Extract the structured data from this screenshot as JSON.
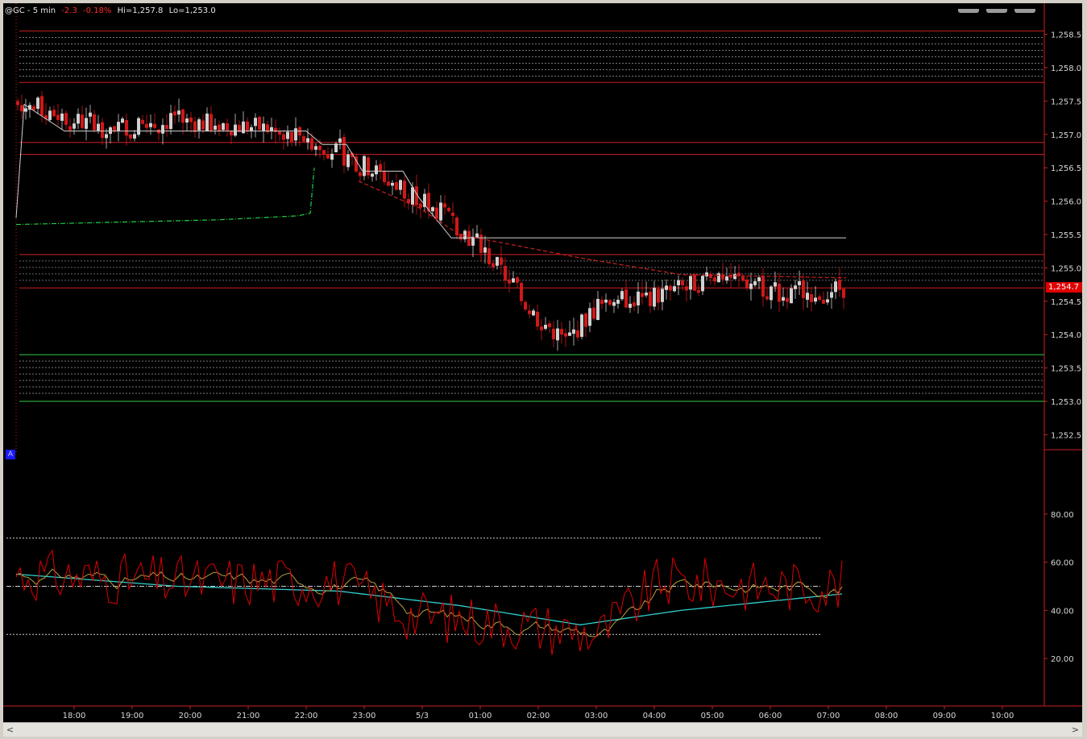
{
  "header": {
    "symbol": "@GC - 5 min",
    "change": "-2.3",
    "change_pct": "-0.18%",
    "high": "Hi=1,257.8",
    "low": "Lo=1,253.0"
  },
  "marker_label": "A",
  "last_price_label": "1,254.7",
  "scroll": {
    "left_arrow": "<",
    "right_arrow": ">"
  },
  "colors": {
    "background": "#000000",
    "up_candle": "#d0d0d0",
    "down_candle": "#d01818",
    "resistance": "#cc2020",
    "support": "#33cc44",
    "vwap": "#22cc44",
    "trail": "#d0d0d0",
    "rsi_fast": "#e00000",
    "rsi_mid": "#b8a040",
    "rsi_slow": "#30d0d0"
  },
  "chart_data": [
    {
      "type": "candlestick",
      "y_ticks": [
        "1,258.5",
        "1,258.0",
        "1,257.5",
        "1,257.0",
        "1,256.5",
        "1,256.0",
        "1,255.5",
        "1,255.0",
        "1,254.5",
        "1,254.0",
        "1,253.5",
        "1,253.0",
        "1,252.5"
      ],
      "ylim": [
        1252.3,
        1258.7
      ],
      "x_ticks": [
        "18:00",
        "19:00",
        "20:00",
        "21:00",
        "22:00",
        "23:00",
        "5/3",
        "01:00",
        "02:00",
        "03:00",
        "04:00",
        "05:00",
        "06:00",
        "07:00",
        "08:00",
        "09:00",
        "10:00"
      ],
      "last_price": 1254.7,
      "high": 1257.8,
      "low": 1253.0,
      "resistance_levels": [
        1258.55,
        1257.78,
        1256.88,
        1256.7,
        1255.2,
        1254.7
      ],
      "resistance_zone_upper": [
        1258.55,
        1257.78
      ],
      "resistance_zone_lower": [
        1255.2,
        1254.7
      ],
      "support_levels": [
        1253.7,
        1253.0
      ],
      "anchors": [
        {
          "x": 0,
          "y": 1257.5
        },
        {
          "x": 20,
          "y": 1257.1
        },
        {
          "x": 40,
          "y": 1257.2
        },
        {
          "x": 60,
          "y": 1257.1
        },
        {
          "x": 70,
          "y": 1257.0
        },
        {
          "x": 84,
          "y": 1256.6
        },
        {
          "x": 96,
          "y": 1256.2
        },
        {
          "x": 108,
          "y": 1255.7
        },
        {
          "x": 118,
          "y": 1255.1
        },
        {
          "x": 128,
          "y": 1254.3
        },
        {
          "x": 136,
          "y": 1253.9
        },
        {
          "x": 145,
          "y": 1254.5
        },
        {
          "x": 160,
          "y": 1254.6
        },
        {
          "x": 175,
          "y": 1254.9
        },
        {
          "x": 190,
          "y": 1254.6
        },
        {
          "x": 205,
          "y": 1254.7
        }
      ],
      "trail_stop": [
        {
          "x": 0,
          "y": 1255.75
        },
        {
          "x": 2,
          "y": 1257.45
        },
        {
          "x": 12,
          "y": 1257.05
        },
        {
          "x": 60,
          "y": 1257.05
        },
        {
          "x": 72,
          "y": 1257.05
        },
        {
          "x": 76,
          "y": 1256.85
        },
        {
          "x": 82,
          "y": 1256.85
        },
        {
          "x": 86,
          "y": 1256.45
        },
        {
          "x": 96,
          "y": 1256.45
        },
        {
          "x": 100,
          "y": 1256.05
        },
        {
          "x": 104,
          "y": 1255.75
        },
        {
          "x": 108,
          "y": 1255.45
        },
        {
          "x": 206,
          "y": 1255.45
        }
      ],
      "vwap": [
        {
          "x": 0,
          "y": 1255.65
        },
        {
          "x": 50,
          "y": 1255.72
        },
        {
          "x": 70,
          "y": 1255.78
        },
        {
          "x": 73,
          "y": 1255.82
        },
        {
          "x": 74,
          "y": 1256.5
        }
      ],
      "vwap2": [
        {
          "x": 85,
          "y": 1256.3
        },
        {
          "x": 100,
          "y": 1255.9
        },
        {
          "x": 110,
          "y": 1255.5
        },
        {
          "x": 140,
          "y": 1255.15
        },
        {
          "x": 165,
          "y": 1254.9
        },
        {
          "x": 206,
          "y": 1254.85
        }
      ]
    },
    {
      "type": "line",
      "y_ticks": [
        "80.00",
        "60.00",
        "40.00",
        "20.00"
      ],
      "ylim": [
        5,
        98
      ],
      "reference_lines": [
        30,
        50,
        70
      ],
      "series": []
    }
  ]
}
